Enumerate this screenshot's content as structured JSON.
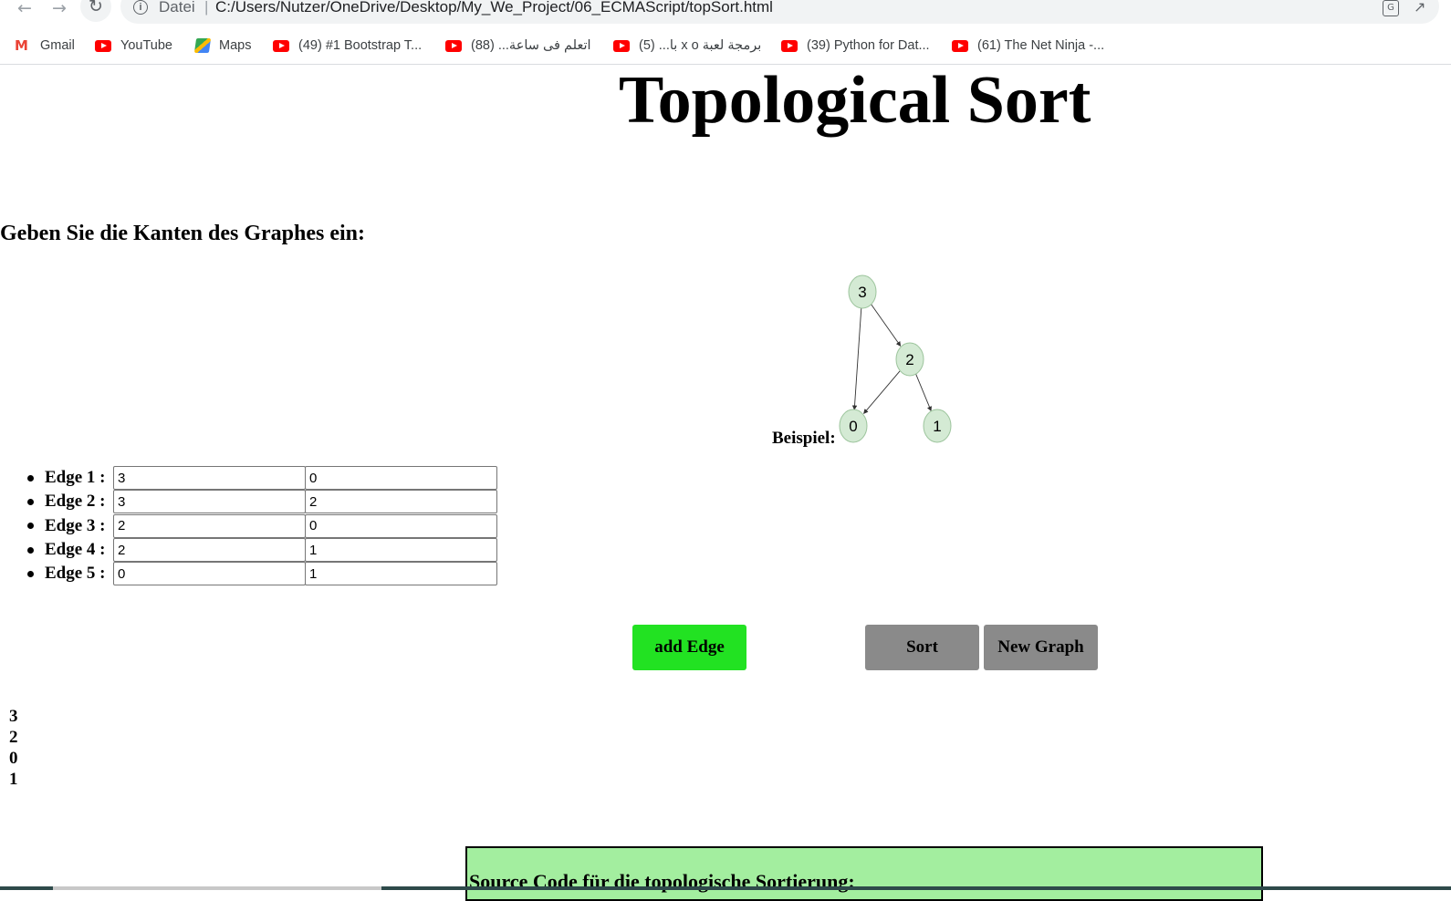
{
  "browser": {
    "scheme_label": "Datei",
    "separator": "|",
    "url": "C:/Users/Nutzer/OneDrive/Desktop/My_We_Project/06_ECMAScript/topSort.html",
    "bookmarks": [
      {
        "label": "Gmail",
        "icon": "gmail-icon"
      },
      {
        "label": "YouTube",
        "icon": "youtube-icon"
      },
      {
        "label": "Maps",
        "icon": "maps-icon"
      },
      {
        "label": "(49) #1 Bootstrap T...",
        "icon": "youtube-icon"
      },
      {
        "label": "اتعلم فى ساعة... (88)",
        "icon": "youtube-icon"
      },
      {
        "label": "برمجة لعبة x o با... (5)",
        "icon": "youtube-icon"
      },
      {
        "label": "(39) Python for Dat...",
        "icon": "youtube-icon"
      },
      {
        "label": "(61) The Net Ninja -...",
        "icon": "youtube-icon"
      }
    ]
  },
  "page": {
    "title": "Topological Sort",
    "prompt": "Geben Sie die Kanten des Graphes ein:",
    "example_label": "Beispiel:",
    "example_graph": {
      "nodes": [
        "3",
        "2",
        "0",
        "1"
      ],
      "edges": [
        [
          "3",
          "2"
        ],
        [
          "3",
          "0"
        ],
        [
          "2",
          "0"
        ],
        [
          "2",
          "1"
        ]
      ],
      "node_fill": "#d4ead4",
      "node_stroke": "#9cc49c"
    },
    "edges": [
      {
        "label": "Edge 1 :",
        "from": "3",
        "to": "0"
      },
      {
        "label": "Edge 2 :",
        "from": "3",
        "to": "2"
      },
      {
        "label": "Edge 3 :",
        "from": "2",
        "to": "0"
      },
      {
        "label": "Edge 4 :",
        "from": "2",
        "to": "1"
      },
      {
        "label": "Edge 5 :",
        "from": "0",
        "to": "1"
      }
    ],
    "buttons": {
      "add_edge": "add Edge",
      "sort": "Sort",
      "new_graph": "New Graph"
    },
    "result": [
      "3",
      "2",
      "0",
      "1"
    ],
    "source_heading": "Source Code für die topologische Sortierung:",
    "colors": {
      "add_button": "#22e222",
      "gray_button": "#8a8a8a",
      "source_box": "#a3ee9f"
    }
  }
}
